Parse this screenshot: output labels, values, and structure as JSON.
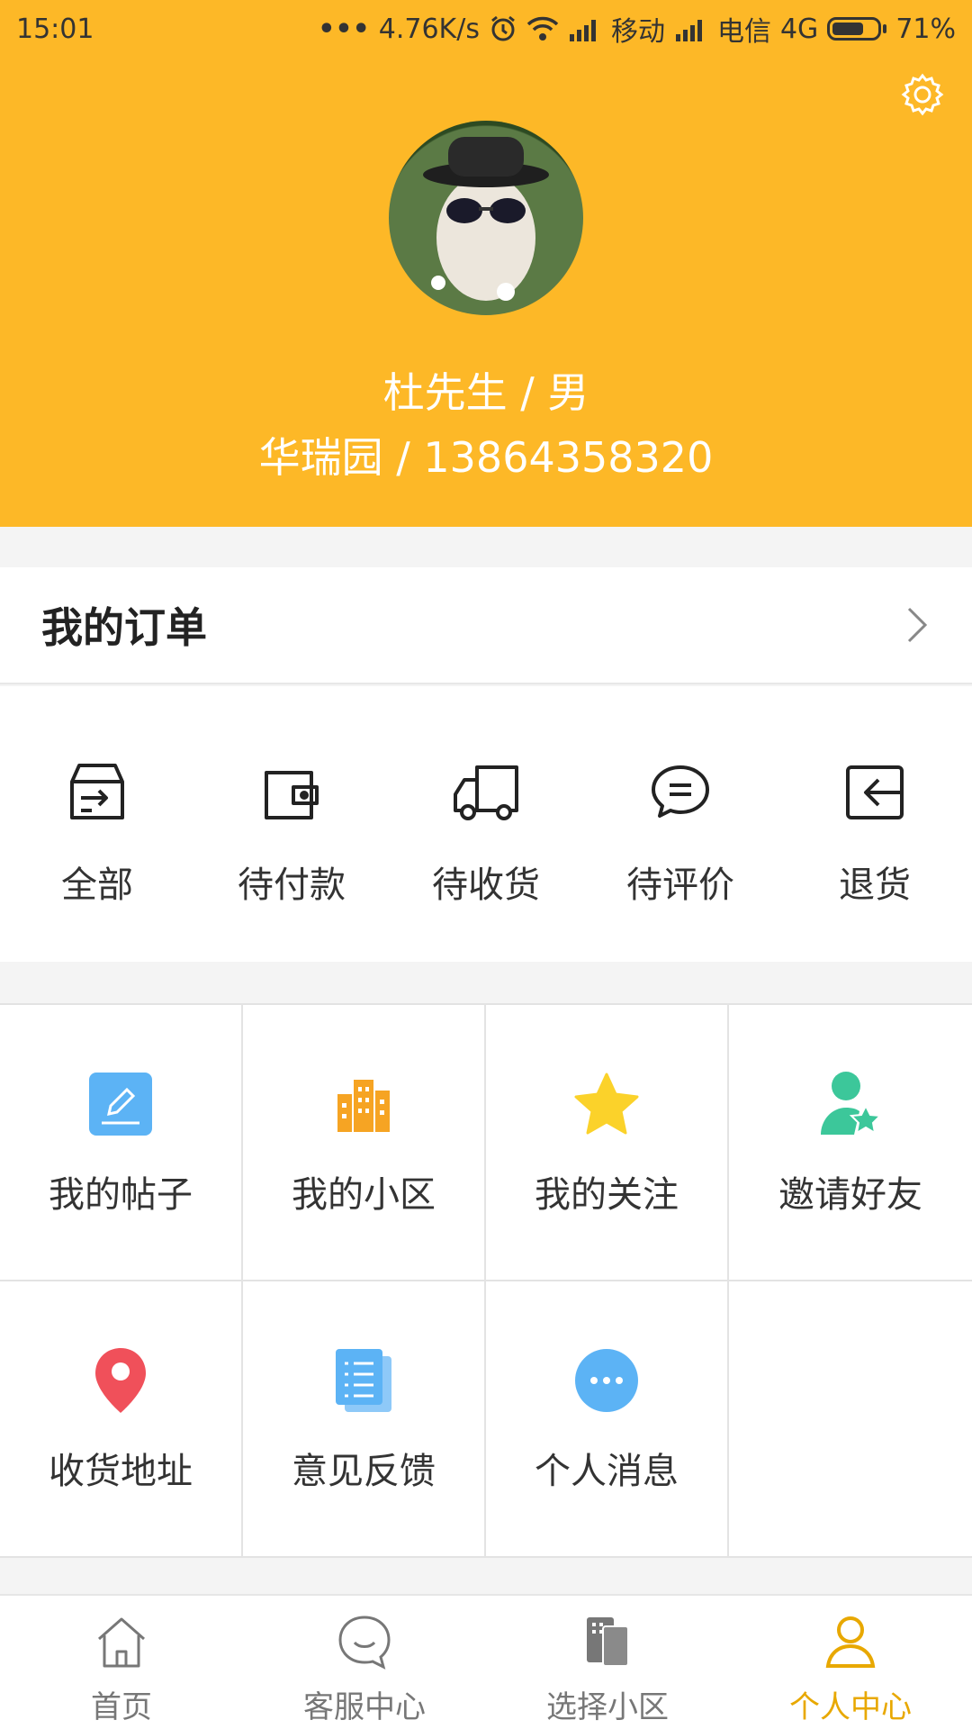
{
  "status_bar": {
    "time": "15:01",
    "speed": "4.76K/s",
    "carrier1": "移动",
    "carrier2": "电信",
    "network": "4G",
    "battery": "71%",
    "battery_level": 0.71
  },
  "profile": {
    "name_gender": "杜先生 / 男",
    "community_phone": "华瑞园 / 13864358320"
  },
  "orders": {
    "title": "我的订单",
    "items": [
      {
        "label": "全部",
        "icon": "box-arrow-icon"
      },
      {
        "label": "待付款",
        "icon": "wallet-icon"
      },
      {
        "label": "待收货",
        "icon": "truck-icon"
      },
      {
        "label": "待评价",
        "icon": "chat-bubble-icon"
      },
      {
        "label": "退货",
        "icon": "return-icon"
      }
    ]
  },
  "grid": {
    "items": [
      {
        "label": "我的帖子",
        "icon": "edit-post-icon",
        "color": "#5CB3F5"
      },
      {
        "label": "我的小区",
        "icon": "building-icon",
        "color": "#F6A423"
      },
      {
        "label": "我的关注",
        "icon": "star-icon",
        "color": "#FBD22A"
      },
      {
        "label": "邀请好友",
        "icon": "invite-user-icon",
        "color": "#3CC79A"
      },
      {
        "label": "收货地址",
        "icon": "location-pin-icon",
        "color": "#F0505A"
      },
      {
        "label": "意见反馈",
        "icon": "feedback-doc-icon",
        "color": "#5CB3F5"
      },
      {
        "label": "个人消息",
        "icon": "message-dots-icon",
        "color": "#5CB3F5"
      }
    ]
  },
  "tabs": [
    {
      "label": "首页",
      "icon": "home-icon"
    },
    {
      "label": "客服中心",
      "icon": "service-icon"
    },
    {
      "label": "选择小区",
      "icon": "select-community-icon"
    },
    {
      "label": "个人中心",
      "icon": "person-icon",
      "active": true
    }
  ],
  "colors": {
    "header_bg": "#FDB827",
    "active_tab": "#E8A800"
  }
}
